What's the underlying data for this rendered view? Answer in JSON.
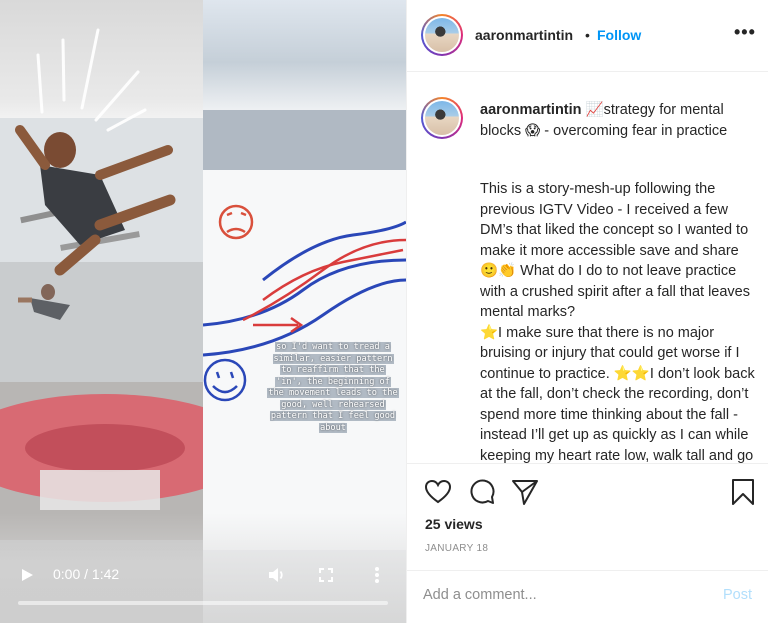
{
  "video": {
    "overlay_lines": [
      "so I'd want to tread a",
      "similar, easier pattern",
      "to reaffirm that the",
      "'in', the beginning of",
      "the movement leads to the",
      "good, well rehearsed",
      "pattern that I feel good",
      "about"
    ],
    "time": "0:00 / 1:42",
    "play_icon": "play-icon",
    "volume_icon": "volume-icon",
    "fullscreen_icon": "fullscreen-icon",
    "more_icon": "vertical-dots-icon"
  },
  "header": {
    "username": "aaronmartintin",
    "separator": "•",
    "follow_label": "Follow",
    "more_label": "•••"
  },
  "caption": {
    "username": "aaronmartintin",
    "title": "📈strategy for mental blocks 😱 - overcoming fear in practice",
    "body": "This is a story-mesh-up following the previous IGTV Video - I received a few DM’s that liked the concept so I wanted to make it more accessible save and share 🙂👏 What do I do to not leave practice with a crushed spirit after a fall that leaves mental marks?\n⭐I make sure that there is no major bruising or injury that could get worse if I continue to practice. ⭐⭐I don’t look back at the fall, don’t check the recording, don’t spend more time thinking about the fall - instead I’ll get up as quickly as I can while keeping my heart rate low, walk tall and go"
  },
  "actions": {
    "views": "25 views",
    "date": "JANUARY 18",
    "comment_placeholder": "Add a comment...",
    "post_label": "Post"
  },
  "colors": {
    "accent": "#0095f6",
    "post_disabled": "#b2dffc",
    "muted": "#8e8e8e"
  }
}
